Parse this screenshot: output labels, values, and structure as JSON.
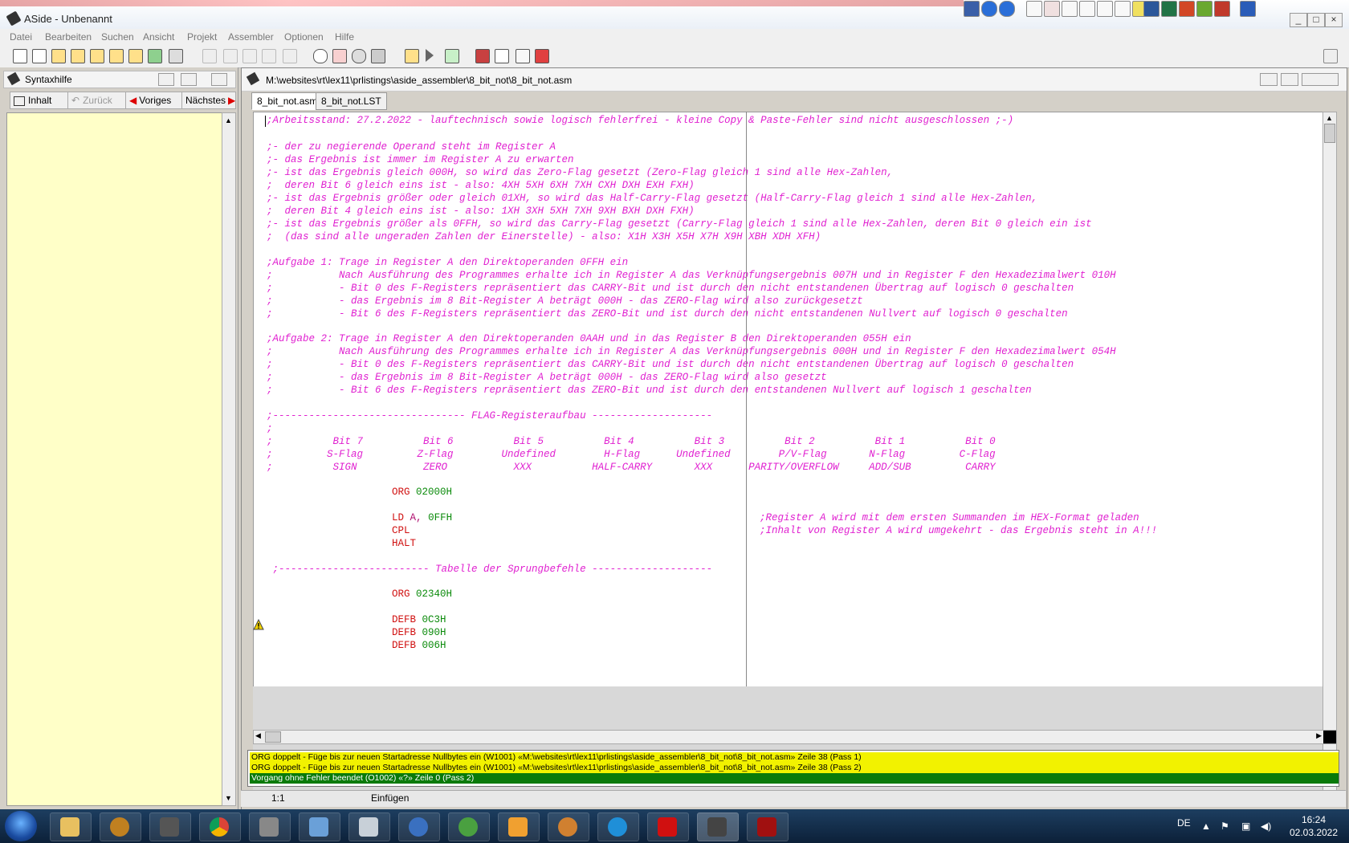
{
  "app": {
    "title": "ASide - Unbenannt",
    "window_buttons": [
      "_",
      "□",
      "×"
    ]
  },
  "menu": [
    "Datei",
    "Bearbeiten",
    "Suchen",
    "Ansicht",
    "Projekt",
    "Assembler",
    "Optionen",
    "Hilfe"
  ],
  "syntax_pane": {
    "title": "Syntaxhilfe",
    "buttons": {
      "contents": "Inhalt",
      "back": "Zurück",
      "prev": "Voriges",
      "next": "Nächstes"
    }
  },
  "editor": {
    "path": "M:\\websites\\rt\\lex11\\prlistings\\aside_assembler\\8_bit_not\\8_bit_not.asm",
    "tabs": [
      "8_bit_not.asm",
      "8_bit_not.LST"
    ],
    "lines": [
      ";Arbeitsstand: 27.2.2022 - lauftechnisch sowie logisch fehlerfrei - kleine Copy & Paste-Fehler sind nicht ausgeschlossen ;-)",
      "",
      ";- der zu negierende Operand steht im Register A",
      ";- das Ergebnis ist immer im Register A zu erwarten",
      ";- ist das Ergebnis gleich 000H, so wird das Zero-Flag gesetzt (Zero-Flag gleich 1 sind alle Hex-Zahlen,",
      ";  deren Bit 6 gleich eins ist - also: 4XH 5XH 6XH 7XH CXH DXH EXH FXH)",
      ";- ist das Ergebnis größer oder gleich 01XH, so wird das Half-Carry-Flag gesetzt (Half-Carry-Flag gleich 1 sind alle Hex-Zahlen,",
      ";  deren Bit 4 gleich eins ist - also: 1XH 3XH 5XH 7XH 9XH BXH DXH FXH)",
      ";- ist das Ergebnis größer als 0FFH, so wird das Carry-Flag gesetzt (Carry-Flag gleich 1 sind alle Hex-Zahlen, deren Bit 0 gleich ein ist",
      ";  (das sind alle ungeraden Zahlen der Einerstelle) - also: X1H X3H X5H X7H X9H XBH XDH XFH)",
      "",
      ";Aufgabe 1: Trage in Register A den Direktoperanden 0FFH ein",
      ";           Nach Ausführung des Programmes erhalte ich in Register A das Verknüpfungsergebnis 007H und in Register F den Hexadezimalwert 010H",
      ";           - Bit 0 des F-Registers repräsentiert das CARRY-Bit und ist durch den nicht entstandenen Übertrag auf logisch 0 geschalten",
      ";           - das Ergebnis im 8 Bit-Register A beträgt 000H - das ZERO-Flag wird also zurückgesetzt",
      ";           - Bit 6 des F-Registers repräsentiert das ZERO-Bit und ist durch den nicht entstandenen Nullvert auf logisch 0 geschalten",
      "",
      ";Aufgabe 2: Trage in Register A den Direktoperanden 0AAH und in das Register B den Direktoperanden 055H ein",
      ";           Nach Ausführung des Programmes erhalte ich in Register A das Verknüpfungsergebnis 000H und in Register F den Hexadezimalwert 054H",
      ";           - Bit 0 des F-Registers repräsentiert das CARRY-Bit und ist durch den nicht entstandenen Übertrag auf logisch 0 geschalten",
      ";           - das Ergebnis im 8 Bit-Register A beträgt 000H - das ZERO-Flag wird also gesetzt",
      ";           - Bit 6 des F-Registers repräsentiert das ZERO-Bit und ist durch den entstandenen Nullvert auf logisch 1 geschalten",
      "",
      ";-------------------------------- FLAG-Registeraufbau --------------------",
      ";",
      ";          Bit 7          Bit 6          Bit 5          Bit 4          Bit 3          Bit 2          Bit 1          Bit 0",
      ";         S-Flag         Z-Flag        Undefined        H-Flag      Undefined        P/V-Flag       N-Flag         C-Flag",
      ";          SIGN           ZERO           XXX          HALF-CARRY       XXX      PARITY/OVERFLOW     ADD/SUB         CARRY"
    ],
    "code": {
      "org1": {
        "kw": "ORG",
        "arg": "02000H"
      },
      "ld": {
        "kw": "LD",
        "reg": "A,",
        "arg": "0FFH",
        "comment": ";Register A wird mit dem ersten Summanden im HEX-Format geladen"
      },
      "cpl": {
        "kw": "CPL",
        "comment": ";Inhalt von Register A wird umgekehrt - das Ergebnis steht in A!!!"
      },
      "halt": {
        "kw": "HALT"
      },
      "jump_table_comment": " ;------------------------- Tabelle der Sprungbefehle --------------------",
      "org2": {
        "kw": "ORG",
        "arg": "02340H"
      },
      "defb": [
        {
          "kw": "DEFB",
          "arg": "0C3H"
        },
        {
          "kw": "DEFB",
          "arg": "090H"
        },
        {
          "kw": "DEFB",
          "arg": "006H"
        }
      ]
    }
  },
  "messages": [
    {
      "text": "ORG doppelt - Füge bis zur neuen Startadresse Nullbytes ein (W1001) «M:\\websites\\rt\\lex11\\prlistings\\aside_assembler\\8_bit_not\\8_bit_not.asm» Zeile 38 (Pass 1)",
      "color": "#f2f200"
    },
    {
      "text": "ORG doppelt - Füge bis zur neuen Startadresse Nullbytes ein (W1001) «M:\\websites\\rt\\lex11\\prlistings\\aside_assembler\\8_bit_not\\8_bit_not.asm» Zeile 38 (Pass 2)",
      "color": "#f2f200"
    },
    {
      "text": "Vorgang ohne Fehler beendet (O1002) «?» Zeile 0 (Pass 2)",
      "color": "#0a7a0a"
    }
  ],
  "status": {
    "position": "1:1",
    "mode": "Einfügen"
  },
  "tray": {
    "lang": "DE",
    "time": "16:24",
    "date": "02.03.2022"
  }
}
